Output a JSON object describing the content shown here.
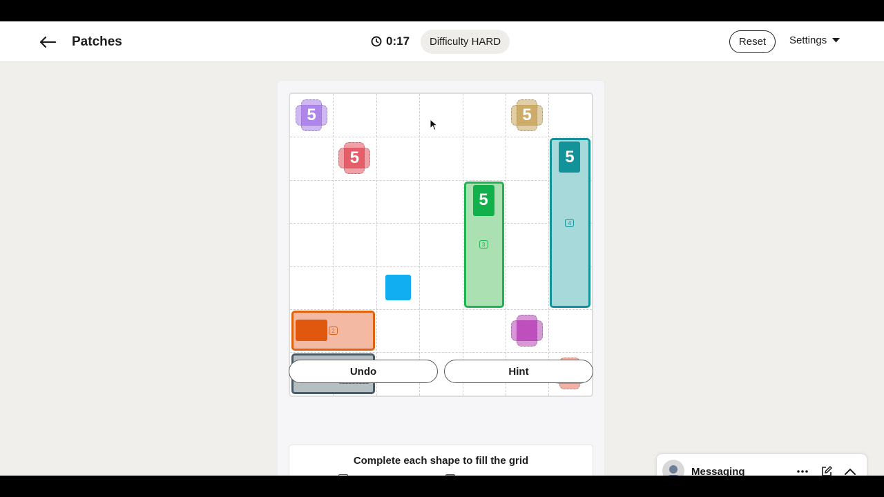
{
  "header": {
    "title": "Patches",
    "timer": "0:17",
    "difficulty": "Difficulty HARD",
    "reset_label": "Reset",
    "settings_label": "Settings"
  },
  "board": {
    "rows": 7,
    "cols": 7,
    "clues": [
      {
        "row": 0,
        "col": 0,
        "value": "5",
        "color": "#a77ce8",
        "shape": "any"
      },
      {
        "row": 0,
        "col": 5,
        "value": "5",
        "color": "#c9a55c",
        "shape": "any"
      },
      {
        "row": 1,
        "col": 1,
        "value": "5",
        "color": "#e2535f",
        "shape": "any"
      },
      {
        "row": 5,
        "col": 5,
        "value": "",
        "color": "#b843b8",
        "shape": "any"
      },
      {
        "row": 6,
        "col": 6,
        "value": "",
        "color": "#e8705f",
        "shape": "any"
      }
    ],
    "placed_shapes": [
      {
        "name": "teal-rect",
        "row": 1,
        "col": 6,
        "rows": 4,
        "cols": 1,
        "clue": "5",
        "size_label": "4",
        "fill": "#a7d8da",
        "border": "#12939a",
        "tag_color": "#12939a"
      },
      {
        "name": "green-rect",
        "row": 2,
        "col": 4,
        "rows": 3,
        "cols": 1,
        "clue": "5",
        "size_label": "3",
        "fill": "#abe0b2",
        "border": "#1fb352",
        "tag_color": "#12b04a"
      },
      {
        "name": "orange-rect",
        "row": 5,
        "col": 0,
        "rows": 1,
        "cols": 2,
        "clue": "",
        "size_label": "2",
        "fill": "#f4b9a2",
        "border": "#e0620f",
        "tag_color": "#e0580d"
      },
      {
        "name": "gray-rect",
        "row": 6,
        "col": 0,
        "rows": 1,
        "cols": 2,
        "clue": "",
        "size_label": "2",
        "fill": "#b5bfc2",
        "border": "#4a5a64",
        "tag_color": "#6a7c84"
      }
    ],
    "loose_piece": {
      "row": 4,
      "col": 2,
      "color": "#11aef2"
    }
  },
  "actions": {
    "undo_label": "Undo",
    "hint_label": "Hint"
  },
  "instructions": {
    "text": "Complete each shape to fill the grid"
  },
  "messaging": {
    "label": "Messaging"
  }
}
